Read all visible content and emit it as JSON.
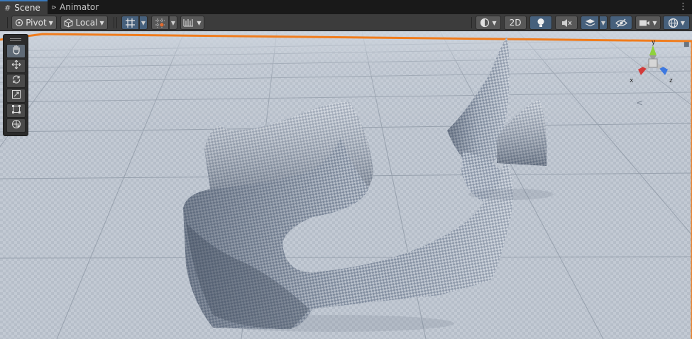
{
  "tabs": [
    {
      "label": "Scene",
      "icon": "hash-grid-icon",
      "active": true
    },
    {
      "label": "Animator",
      "icon": "animator-arrows-icon",
      "active": false
    }
  ],
  "toolbar": {
    "pivot_label": "Pivot",
    "local_label": "Local",
    "two_d_label": "2D"
  },
  "palette": {
    "tools": [
      "hand-tool",
      "move-tool",
      "rotate-tool",
      "scale-tool",
      "rect-tool",
      "transform-tool"
    ],
    "selected": "hand-tool"
  },
  "gizmo": {
    "axis_y": "y",
    "axis_x": "x",
    "axis_z": "z",
    "view_mode_glyph": "<"
  },
  "colors": {
    "accent": "#3a79bb",
    "selection_outline": "#f07c1d",
    "toolbar_bg": "#3c3c3c",
    "axis_x": "#d33a3a",
    "axis_y": "#8fd13c",
    "axis_z": "#3d78e0"
  }
}
